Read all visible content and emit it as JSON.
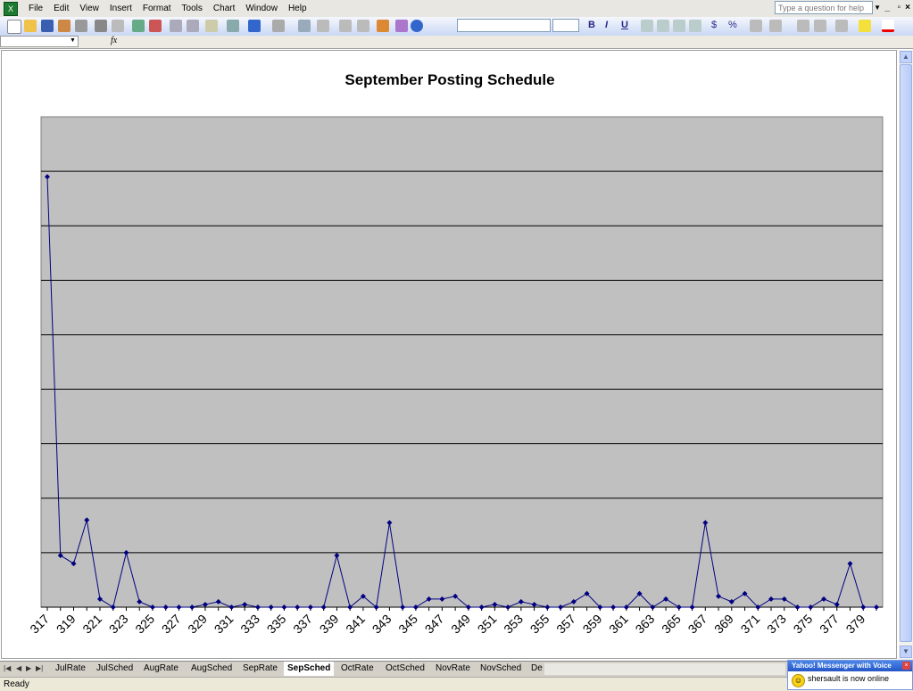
{
  "menubar": {
    "items": [
      "File",
      "Edit",
      "View",
      "Insert",
      "Format",
      "Tools",
      "Chart",
      "Window",
      "Help"
    ],
    "help_placeholder": "Type a question for help"
  },
  "formula_bar": {
    "fx_label": "fx"
  },
  "icons": [
    "excel-icon",
    "new-icon",
    "open-icon",
    "save-icon",
    "permission-icon",
    "print-icon",
    "print-preview-icon",
    "spelling-icon",
    "research-icon",
    "cut-icon",
    "copy-icon",
    "paste-icon",
    "format-painter-icon",
    "undo-icon",
    "redo-icon",
    "hyperlink-icon",
    "autosum-icon",
    "sort-asc-icon",
    "sort-desc-icon",
    "chart-wizard-icon",
    "drawing-icon",
    "help-icon",
    "align-left-icon",
    "center-icon",
    "align-right-icon",
    "merge-icon",
    "borders-icon",
    "fill-color-icon",
    "font-color-icon"
  ],
  "toolbar": {
    "bold": "B",
    "italic": "I",
    "underline": "U",
    "currency": "$",
    "percent": "%"
  },
  "chart_data": {
    "type": "line",
    "title": "September Posting Schedule",
    "x": [
      317,
      318,
      319,
      320,
      321,
      322,
      323,
      324,
      325,
      326,
      327,
      328,
      329,
      330,
      331,
      332,
      333,
      334,
      335,
      336,
      337,
      338,
      339,
      340,
      341,
      342,
      343,
      344,
      345,
      346,
      347,
      348,
      349,
      350,
      351,
      352,
      353,
      354,
      355,
      356,
      357,
      358,
      359,
      360,
      361,
      362,
      363,
      364,
      365,
      366,
      367,
      368,
      369,
      370,
      371,
      372,
      373,
      374,
      375,
      376,
      377,
      378,
      379,
      380
    ],
    "x_tick_labels": [
      "317",
      "319",
      "321",
      "323",
      "325",
      "327",
      "329",
      "331",
      "333",
      "335",
      "337",
      "339",
      "341",
      "343",
      "345",
      "347",
      "349",
      "351",
      "353",
      "355",
      "357",
      "359",
      "361",
      "363",
      "365",
      "367",
      "369",
      "371",
      "373",
      "375",
      "377",
      "379"
    ],
    "values": [
      79,
      9.5,
      8,
      16,
      1.5,
      0,
      10,
      1,
      0,
      0,
      0,
      0,
      0.5,
      1,
      0,
      0.5,
      0,
      0,
      0,
      0,
      0,
      0,
      9.5,
      0,
      2,
      0,
      15.5,
      0,
      0,
      1.5,
      1.5,
      2,
      0,
      0,
      0.5,
      0,
      1,
      0.5,
      0,
      0,
      1,
      2.5,
      0,
      0,
      0,
      2.5,
      0,
      1.5,
      0,
      0,
      15.5,
      2,
      1,
      2.5,
      0,
      1.5,
      1.5,
      0,
      0,
      1.5,
      0.5,
      8,
      0,
      0
    ],
    "ylim": [
      0,
      90
    ],
    "y_gridline_step": 10,
    "y_tick_labels_shown": false,
    "plot_background": "#c0c0c0",
    "line_color": "#000080",
    "legend": "none"
  },
  "sheet_tabs": {
    "tabs": [
      "JulRate",
      "JulSched",
      "AugRate",
      "AugSched",
      "SepRate",
      "SepSched",
      "OctRate",
      "OctSched",
      "NovRate",
      "NovSched",
      "De"
    ],
    "active": "SepSched"
  },
  "statusbar": {
    "text": "Ready"
  },
  "yahoo": {
    "title": "Yahoo! Messenger with Voice",
    "message": "shersault is now online"
  }
}
